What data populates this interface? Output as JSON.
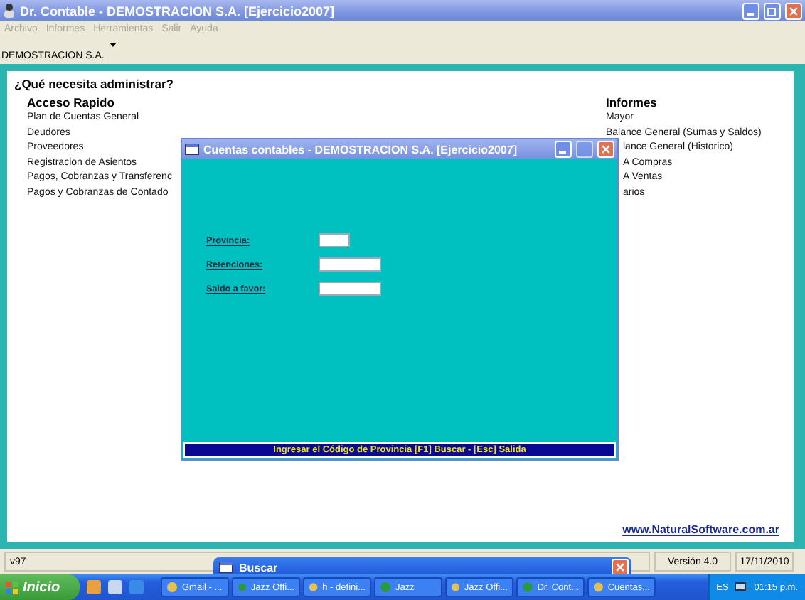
{
  "window": {
    "title": "Dr. Contable - DEMOSTRACION S.A.  [Ejercicio2007]"
  },
  "menu": [
    {
      "label": "Archivo",
      "disabled": true
    },
    {
      "label": "Informes",
      "disabled": true
    },
    {
      "label": "Herramientas",
      "disabled": true
    },
    {
      "label": "Salir",
      "disabled": true
    },
    {
      "label": "Ayuda",
      "disabled": true
    }
  ],
  "company": "DEMOSTRACION S.A.",
  "heading": "¿Qué necesita administrar?",
  "quick_access": {
    "title": "Acceso Rapido",
    "items": [
      "Plan de Cuentas General",
      "Deudores",
      "Proveedores",
      "Registracion de Asientos",
      "Pagos, Cobranzas y Transferenc",
      "Pagos y Cobranzas de Contado"
    ]
  },
  "reports": {
    "title": "Informes",
    "items": [
      "Mayor",
      "Balance General (Sumas y Saldos)",
      "lance General (Historico)",
      "A Compras",
      "A Ventas",
      "arios"
    ]
  },
  "website": "www.NaturalSoftware.com.ar",
  "status_bar": {
    "build": "v97",
    "version": "Versión 4.0",
    "date": "17/11/2010"
  },
  "dialog": {
    "title": "Cuentas contables - DEMOSTRACION S.A.  [Ejercicio2007]",
    "fields": [
      {
        "label": "Provincia:",
        "kind": "code"
      },
      {
        "label": "Retenciones:",
        "kind": "amount"
      },
      {
        "label": "Saldo a favor:",
        "kind": "amount"
      }
    ],
    "hint": "Ingresar el Código de Provincia [F1] Buscar - [Esc] Salida"
  },
  "search_window": {
    "title": "Buscar"
  },
  "taskbar": {
    "start": "Inicio",
    "buttons": [
      {
        "label": "Gmail - ...",
        "selected": false
      },
      {
        "label": "Jazz Offi...",
        "selected": false
      },
      {
        "label": "h - defini...",
        "selected": false
      },
      {
        "label": "Jazz",
        "selected": false
      },
      {
        "label": "Jazz Offi...",
        "selected": false
      },
      {
        "label": "Dr. Cont...",
        "selected": false
      },
      {
        "label": "Cuentas...",
        "selected": false
      }
    ],
    "language": "ES",
    "clock": "01:15 p.m."
  }
}
